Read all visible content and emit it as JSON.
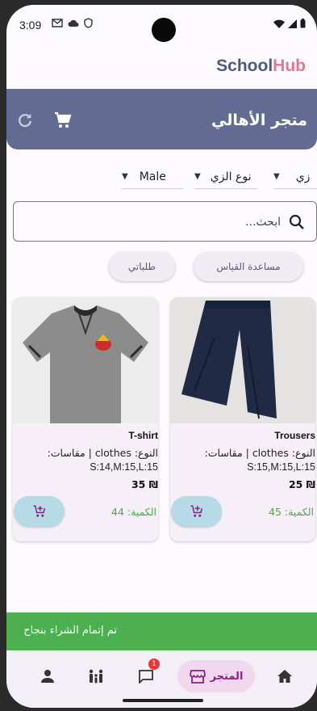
{
  "status_bar": {
    "time": "3:09"
  },
  "brand": {
    "part1": "School",
    "part2": "Hub"
  },
  "appbar": {
    "title": "متجر الأهالي"
  },
  "filters": {
    "gender": "Male",
    "uniform_type": "نوع الزي",
    "uniform": "زي"
  },
  "search": {
    "placeholder": "ابحث..."
  },
  "chips": {
    "size_help": "مساعدة القياس",
    "my_orders": "طلباتي"
  },
  "products": [
    {
      "name": "Trousers",
      "meta": "النوع: clothes | مقاسات:",
      "sizes": "S:15,M:15,L:15",
      "price": "25 ₪",
      "quantity": "الكمية: 45"
    },
    {
      "name": "T-shirt",
      "meta": "النوع: clothes | مقاسات:",
      "sizes": "S:14,M:15,L:15",
      "price": "35 ₪",
      "quantity": "الكمية: 44"
    }
  ],
  "snackbar": {
    "message": "تم إتمام الشراء بنجاح"
  },
  "bottom_nav": {
    "store_label": "المتجر",
    "messages_badge": "1"
  },
  "colors": {
    "appbar": "#626c92",
    "brand_primary": "#4f5a80",
    "brand_accent": "#e5768e",
    "snackbar": "#4caf50",
    "quantity": "#4aaa4a",
    "store_active": "#8a1f8a"
  }
}
